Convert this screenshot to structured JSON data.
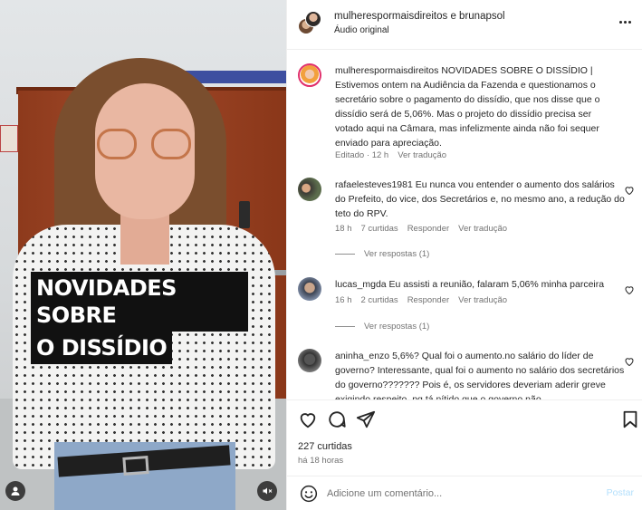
{
  "media": {
    "caption_line1": "NOVIDADES SOBRE",
    "caption_line2": "O DISSÍDIO",
    "user_tag_icon": "user-tag-icon",
    "mute_icon": "speaker-muted-icon"
  },
  "header": {
    "title": "mulherespormaisdireitos e brunapsol",
    "subtitle": "Áudio original",
    "more_icon": "more-horizontal-icon"
  },
  "post": {
    "user": "mulherespormaisdireitos",
    "text": "NOVIDADES SOBRE O DISSÍDIO | Estivemos ontem na Audiência da Fazenda e questionamos o secretário sobre o pagamento do dissídio, que nos disse que o dissídio será de 5,06%. Mas o projeto do dissídio precisa ser votado aqui na Câmara, mas infelizmente ainda não foi sequer enviado para apreciação.",
    "edited": "Editado",
    "time": "12 h",
    "translate": "Ver tradução"
  },
  "comments": [
    {
      "user": "rafaelesteves1981",
      "text": "Eu nunca vou entender o aumento dos salários do Prefeito, do vice, dos Secretários e, no mesmo ano, a redução do teto do RPV.",
      "time": "18 h",
      "likes": "7 curtidas",
      "reply": "Responder",
      "translate": "Ver tradução",
      "replies": "Ver respostas (1)"
    },
    {
      "user": "lucas_mgda",
      "text": "Eu assisti a reunião, falaram 5,06% minha parceira",
      "time": "16 h",
      "likes": "2 curtidas",
      "reply": "Responder",
      "translate": "Ver tradução",
      "replies": "Ver respostas (1)"
    },
    {
      "user": "aninha_enzo",
      "text": "5,6%? Qual foi o aumento.no salário do líder de governo? Interessante, qual foi o aumento no salário dos secretários do governo??????? Pois é, os servidores deveriam aderir greve exigindo respeito, pq tá nítido que o governo não"
    }
  ],
  "actions": {
    "like_icon": "heart-icon",
    "comment_icon": "comment-icon",
    "share_icon": "share-icon",
    "save_icon": "bookmark-icon",
    "likes": "227 curtidas",
    "ago": "há 18 horas"
  },
  "composer": {
    "emoji_icon": "emoji-icon",
    "placeholder": "Adicione um comentário...",
    "post_label": "Postar"
  },
  "colors": {
    "muted_text": "#737373",
    "post_button_disabled": "#b2dffc",
    "border": "#efefef"
  }
}
